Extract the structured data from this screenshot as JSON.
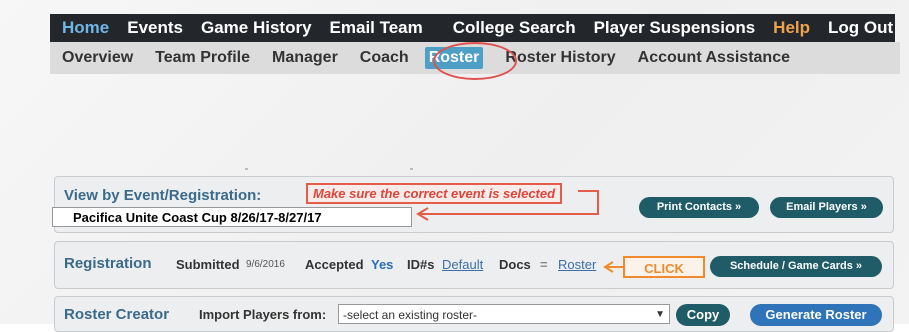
{
  "top_nav": {
    "items": [
      "Home",
      "Events",
      "Game History",
      "Email Team",
      "College Search",
      "Player Suspensions",
      "Help",
      "Log Out"
    ]
  },
  "sub_nav": {
    "items": [
      "Overview",
      "Team Profile",
      "Manager",
      "Coach",
      "Roster",
      "Roster History",
      "Account Assistance"
    ]
  },
  "event_panel": {
    "title": "View by Event/Registration:",
    "annotation": "Make sure the correct event is selected",
    "selected_event": "Pacifica Unite Coast Cup 8/26/17-8/27/17",
    "print_button": "Print Contacts »",
    "email_button": "Email Players »"
  },
  "registration_panel": {
    "title": "Registration",
    "submitted_label": "Submitted",
    "submitted_date": "9/6/2016",
    "accepted_label": "Accepted",
    "accepted_value": "Yes",
    "ids_label": "ID#s",
    "ids_link": "Default",
    "docs_label": "Docs",
    "docs_link": "Roster",
    "click_annotation": "CLICK",
    "schedule_button": "Schedule / Game Cards »"
  },
  "roster_creator": {
    "title": "Roster Creator",
    "import_label": "Import Players from:",
    "select_value": "-select an existing roster-",
    "copy_button": "Copy",
    "generate_button": "Generate Roster"
  },
  "colors": {
    "nav_bg": "#23272b",
    "active_nav": "#6fb6e6",
    "help": "#f0a24a",
    "annotation_red": "#e55c4a",
    "annotation_orange": "#f08a2c",
    "button_teal": "#1f5c67",
    "button_blue": "#2f73b8"
  }
}
